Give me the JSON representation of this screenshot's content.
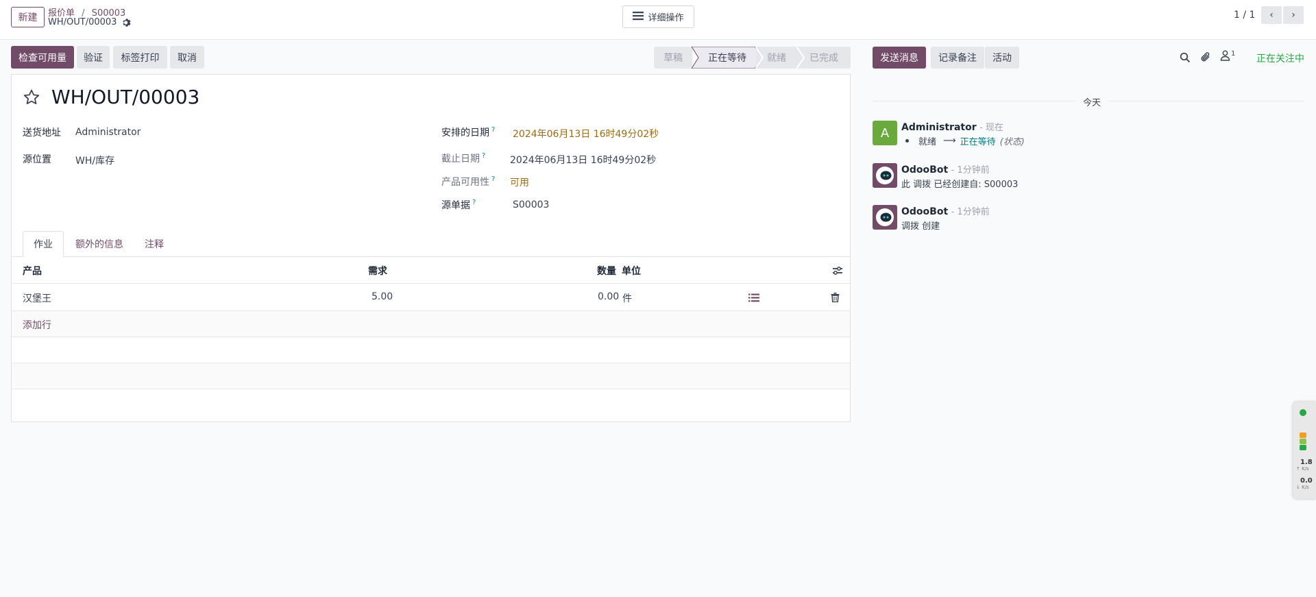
{
  "topbar": {
    "new_button": "新建",
    "breadcrumb_parent": "报价单",
    "breadcrumb_sep": "/",
    "breadcrumb_ref": "S00003",
    "record_name": "WH/OUT/00003",
    "actions_button": "详细操作",
    "pager": "1 / 1"
  },
  "toolbar": {
    "check_availability": "检查可用量",
    "validate": "验证",
    "print_labels": "标签打印",
    "cancel": "取消"
  },
  "statusbar": {
    "steps": [
      "草稿",
      "正在等待",
      "就绪",
      "已完成"
    ],
    "active": "正在等待"
  },
  "form": {
    "title": "WH/OUT/00003",
    "delivery_address_label": "送货地址",
    "delivery_address_value": "Administrator",
    "source_location_label": "源位置",
    "source_location_value": "WH/库存",
    "scheduled_date_label": "安排的日期",
    "scheduled_date_value": "2024年06月13日 16时49分02秒",
    "deadline_label": "截止日期",
    "deadline_value": "2024年06月13日 16时49分02秒",
    "availability_label": "产品可用性",
    "availability_value": "可用",
    "source_doc_label": "源单据",
    "source_doc_value": "S00003",
    "help_mark": "?"
  },
  "tabs": [
    "作业",
    "额外的信息",
    "注释"
  ],
  "table": {
    "headers": {
      "product": "产品",
      "demand": "需求",
      "quantity": "数量",
      "uom": "单位"
    },
    "rows": [
      {
        "product": "汉堡王",
        "demand": "5.00",
        "quantity": "0.00",
        "uom": "件"
      }
    ],
    "add_line": "添加行"
  },
  "chatter": {
    "send_message": "发送消息",
    "log_note": "记录备注",
    "activities": "活动",
    "followers_count": "1",
    "following": "正在关注中",
    "date_separator": "今天",
    "messages": [
      {
        "author": "Administrator",
        "time": "- 现在",
        "avatar_letter": "A",
        "old_value": "就绪",
        "arrow": "⟶",
        "new_value": "正在等待",
        "field": "(状态)"
      },
      {
        "author": "OdooBot",
        "time": "- 1分钟前",
        "body": "此 调拨 已经创建自: S00003"
      },
      {
        "author": "OdooBot",
        "time": "- 1分钟前",
        "body": "调拨 创建"
      }
    ]
  },
  "side_widget": {
    "upload_value": "1.8",
    "upload_unit": "K/s",
    "download_value": "0.0",
    "download_unit": "K/s"
  },
  "colors": {
    "brand": "#714b67",
    "warning_text": "#9a6b12",
    "link": "#017e84",
    "green": "#28a745"
  }
}
